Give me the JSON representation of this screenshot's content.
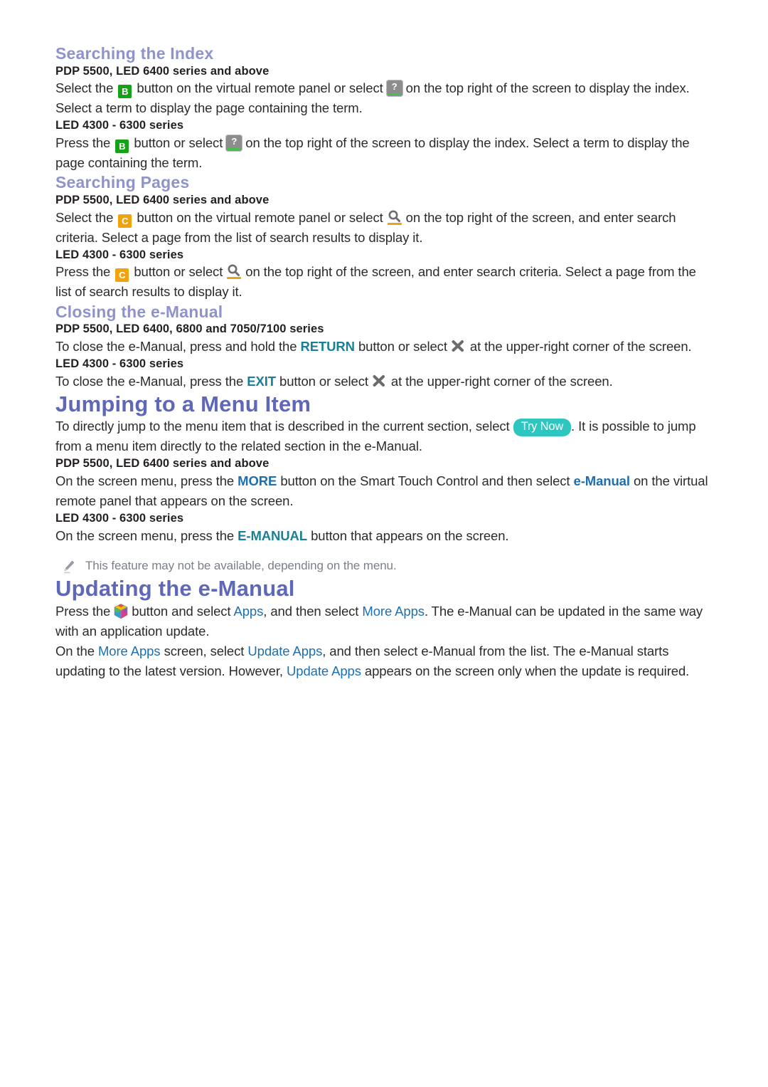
{
  "page": {
    "background": "#ffffff",
    "accent_heading": "#5f67b8",
    "accent_subheading": "#8e93cc",
    "accent_teal": "#1b7f96",
    "accent_blue": "#1d6fb0",
    "try_now_bg": "#2fc6c0",
    "key_b_bg": "#16a117",
    "key_c_bg": "#f0a30a",
    "note_color": "#7a7f88"
  },
  "sections": {
    "searching_index": {
      "title": "Searching the Index",
      "block_a": {
        "subhead": "PDP 5500, LED 6400 series and above",
        "text_1": "Select the",
        "key_label": "B",
        "text_2": "button on the virtual remote panel or select",
        "text_3": "on the top right of the screen to display the index. Select a term to display the page containing the term."
      },
      "block_b": {
        "subhead": "LED 4300 - 6300 series",
        "text_1": "Press the",
        "key_label": "B",
        "text_2": "button or select",
        "text_3": "on the top right of the screen to display the index. Select a term to display the page containing the term."
      }
    },
    "searching_pages": {
      "title": "Searching Pages",
      "block_a": {
        "subhead": "PDP 5500, LED 6400 series and above",
        "text_1": "Select the",
        "key_label": "C",
        "text_2": "button on the virtual remote panel or select",
        "text_3": "on the top right of the screen, and enter search criteria. Select a page from the list of search results to display it."
      },
      "block_b": {
        "subhead": "LED 4300 - 6300 series",
        "text_1": "Press the",
        "key_label": "C",
        "text_2": "button or select",
        "text_3": "on the top right of the screen, and enter search criteria. Select a page from the list of search results to display it."
      }
    },
    "closing_emanual": {
      "title": "Closing the e-Manual",
      "block_a": {
        "subhead": "PDP 5500, LED 6400, 6800 and 7050/7100 series",
        "text_1": "To close the e-Manual, press and hold the",
        "term": "RETURN",
        "text_2": "button or select",
        "text_3": "at the upper-right corner of the screen."
      },
      "block_b": {
        "subhead": "LED 4300 - 6300 series",
        "text_1": "To close the e-Manual, press the",
        "term": "EXIT",
        "text_2": "button or select",
        "text_3": "at the upper-right corner of the screen."
      }
    },
    "jumping_menu": {
      "title": "Jumping to a Menu Item",
      "intro": {
        "text_1": "To directly jump to the menu item that is described in the current section, select",
        "badge": "Try Now",
        "text_2": ". It is possible to jump from a menu item directly to the related section in the e-Manual."
      },
      "block_a": {
        "subhead": "PDP 5500, LED 6400 series and above",
        "text_1": "On the screen menu, press the",
        "term_1": "MORE",
        "text_2": "button on the Smart Touch Control and then select",
        "term_2": "e-Manual",
        "text_3": "on the virtual remote panel that appears on the screen."
      },
      "block_b": {
        "subhead": "LED 4300 - 6300 series",
        "text_1": "On the screen menu, press the",
        "term_1": "E-MANUAL",
        "text_2": "button that appears on the screen."
      },
      "note": "This feature may not be available, depending on the menu."
    },
    "updating_emanual": {
      "title": "Updating the e-Manual",
      "para_1": {
        "text_1": "Press the",
        "text_2": "button and select",
        "term_1": "Apps",
        "text_3": ", and then select",
        "term_2": "More Apps",
        "text_4": ". The e-Manual can be updated in the same way with an application update."
      },
      "para_2": {
        "text_1": "On the",
        "term_1": "More Apps",
        "text_2": "screen, select",
        "term_2": "Update Apps",
        "text_3": ", and then select e-Manual from the list. The e-Manual starts updating to the latest version. However,",
        "term_3": "Update Apps",
        "text_4": "appears on the screen only when the update is required."
      }
    }
  },
  "icons": {
    "index": "index-question-icon",
    "search": "search-magnifier-icon",
    "close": "close-x-icon",
    "hub": "smart-hub-cube-icon",
    "note": "pencil-note-icon"
  }
}
